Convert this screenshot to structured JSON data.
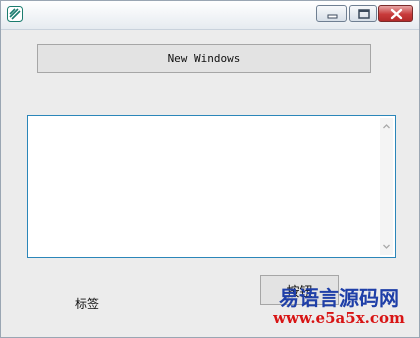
{
  "window": {
    "icon": "app-icon",
    "controls": {
      "minimize_icon": "minimize-icon",
      "maximize_icon": "maximize-icon",
      "close_icon": "close-icon"
    }
  },
  "buttons": {
    "new_windows_label": "New Windows",
    "second_button_label": "按钮"
  },
  "textbox": {
    "value": ""
  },
  "label": {
    "text": "标签"
  },
  "watermark": {
    "title": "易语言源码网",
    "url": "www.e5a5x.com"
  },
  "colors": {
    "textbox_border": "#2b86b9",
    "watermark_title": "#1f3fa8",
    "watermark_url": "#d81414",
    "close_button": "#c83b3b"
  }
}
